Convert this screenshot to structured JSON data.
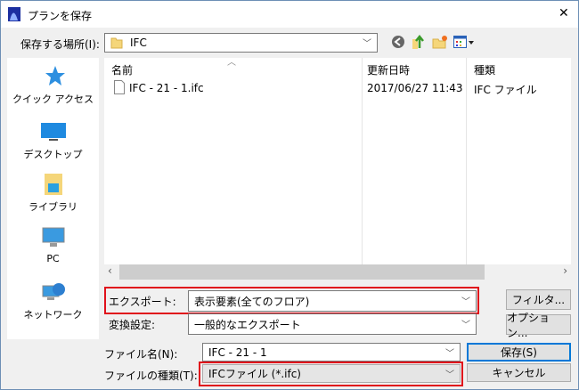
{
  "window": {
    "title": "プランを保存",
    "close": "✕"
  },
  "location": {
    "label": "保存する場所(I):",
    "value": "IFC"
  },
  "sidebar": {
    "items": [
      {
        "label": "クイック アクセス"
      },
      {
        "label": "デスクトップ"
      },
      {
        "label": "ライブラリ"
      },
      {
        "label": "PC"
      },
      {
        "label": "ネットワーク"
      }
    ]
  },
  "list": {
    "columns": [
      "名前",
      "更新日時",
      "種類"
    ],
    "rows": [
      {
        "name": "IFC - 21 - 1.ifc",
        "modified": "2017/06/27 11:43",
        "type": "IFC ファイル"
      }
    ]
  },
  "export": {
    "label": "エクスポート:",
    "value": "表示要素(全てのフロア)",
    "filter_button": "フィルタ..."
  },
  "conversion": {
    "label": "変換設定:",
    "value": "一般的なエクスポート",
    "options_button": "オプション..."
  },
  "filename": {
    "label": "ファイル名(N):",
    "value": "IFC - 21 - 1",
    "save_button": "保存(S)"
  },
  "filetype": {
    "label": "ファイルの種類(T):",
    "value": "IFCファイル (*.ifc)",
    "cancel_button": "キャンセル"
  },
  "colors": {
    "highlight": "#e0111b",
    "accent": "#0078d7"
  }
}
